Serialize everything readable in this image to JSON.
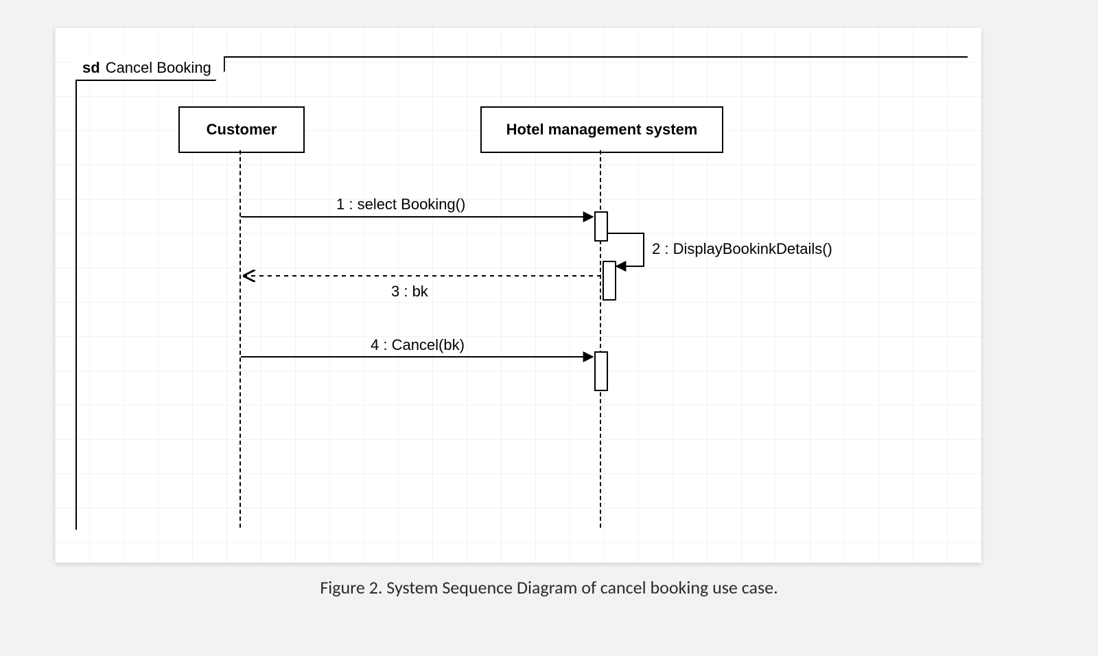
{
  "frame": {
    "keyword": "sd",
    "title": "Cancel Booking"
  },
  "participants": {
    "customer": "Customer",
    "hotel": "Hotel management system"
  },
  "messages": {
    "m1": "1 : select Booking()",
    "m2": "2 : DisplayBookinkDetails()",
    "m3": "3 : bk",
    "m4": "4 : Cancel(bk)"
  },
  "caption": "Figure 2. System Sequence Diagram of cancel booking use case."
}
